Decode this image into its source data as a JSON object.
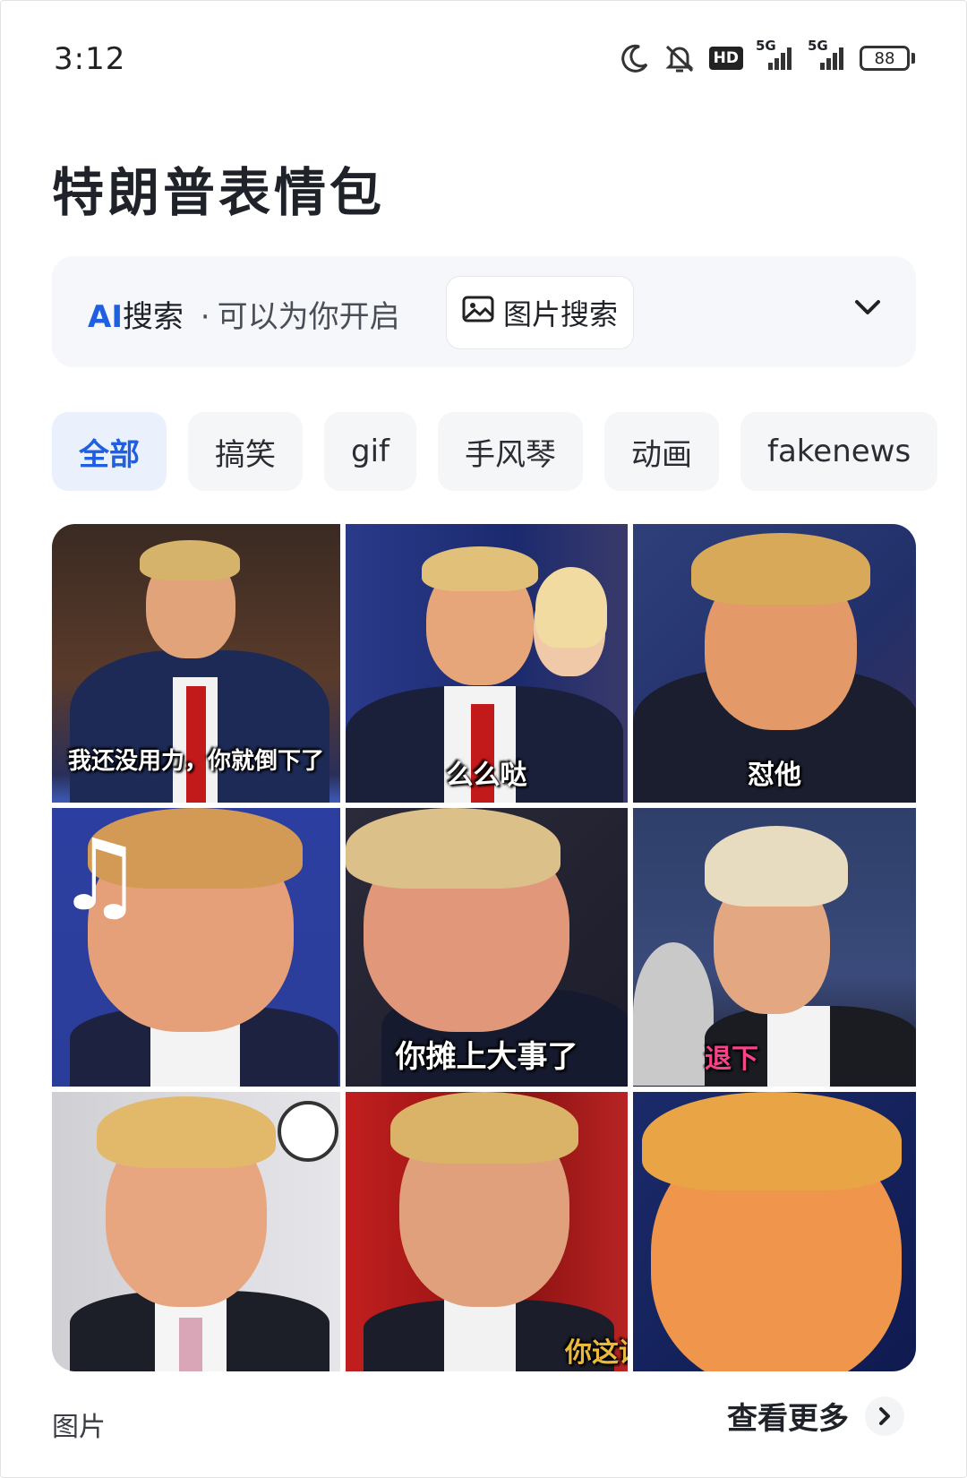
{
  "status_bar": {
    "time": "3:12",
    "network_1": "5G",
    "network_2": "5G",
    "hd_badge": "HD",
    "battery": "88"
  },
  "header": {
    "title": "特朗普表情包"
  },
  "ai_search": {
    "ai_label": "AI",
    "search_label": "搜索",
    "separator": "·",
    "hint": "可以为你开启",
    "image_search_label": "图片搜索"
  },
  "chips": [
    {
      "label": "全部",
      "active": true
    },
    {
      "label": "搞笑",
      "active": false
    },
    {
      "label": "gif",
      "active": false
    },
    {
      "label": "手风琴",
      "active": false
    },
    {
      "label": "动画",
      "active": false
    },
    {
      "label": "fakenews",
      "active": false
    }
  ],
  "images": [
    {
      "caption": "我还没用力，你就倒下了"
    },
    {
      "caption": "么么哒"
    },
    {
      "caption": "怼他"
    },
    {
      "caption": ""
    },
    {
      "caption": "你摊上大事了"
    },
    {
      "caption": "退下"
    },
    {
      "caption": ""
    },
    {
      "caption": "你这话"
    },
    {
      "caption": ""
    }
  ],
  "footer": {
    "section_label": "图片",
    "see_more": "查看更多"
  },
  "colors": {
    "accent": "#1f5fe0",
    "active_chip_bg": "#eaf1fd"
  }
}
